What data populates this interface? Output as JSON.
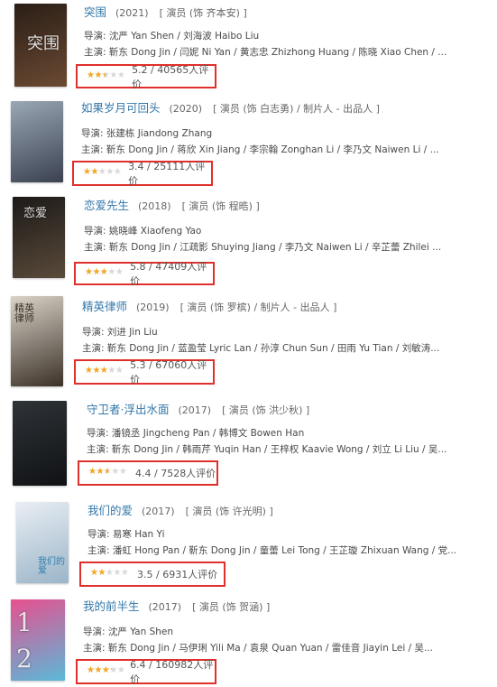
{
  "items": [
    {
      "title": "突围",
      "year": "(2021)",
      "role": "[ 演员 (饰 齐本安) ]",
      "director": "导演: 沈严 Yan Shen / 刘海波 Haibo Liu",
      "cast": "主演: 靳东 Dong Jin / 闫妮 Ni Yan / 黄志忠 Zhizhong Huang / 陈晓 Xiao Chen / ...",
      "score": "5.2 / 40565人评价",
      "stars": 2.5,
      "poster_colors": [
        "#2a1e16",
        "#6b4a33"
      ],
      "poster_text": "突围"
    },
    {
      "title": "如果岁月可回头",
      "year": "(2020)",
      "role": "[ 演员 (饰 白志勇) / 制片人 - 出品人 ]",
      "director": "导演: 张建栋 Jiandong Zhang",
      "cast": "主演: 靳东 Dong Jin / 蒋欣 Xin Jiang / 李宗翰 Zonghan Li / 李乃文 Naiwen Li / ...",
      "score": "3.4 / 25111人评价",
      "stars": 2,
      "poster_colors": [
        "#9aa7b5",
        "#3a4150"
      ],
      "poster_text": ""
    },
    {
      "title": "恋爱先生",
      "year": "(2018)",
      "role": "[ 演员 (饰 程晧) ]",
      "director": "导演: 姚晓峰 Xiaofeng Yao",
      "cast": "主演: 靳东 Dong Jin / 江疏影 Shuying Jiang / 李乃文 Naiwen Li / 辛芷蕾 Zhilei ...",
      "score": "5.8 / 47409人评价",
      "stars": 3,
      "poster_colors": [
        "#1c1a18",
        "#5a4a3a"
      ],
      "poster_text": "恋爱"
    },
    {
      "title": "精英律师",
      "year": "(2019)",
      "role": "[ 演员 (饰 罗槟) / 制片人 - 出品人 ]",
      "director": "导演: 刘进 Jin Liu",
      "cast": "主演: 靳东 Dong Jin / 蓝盈莹 Lyric Lan / 孙淳 Chun Sun / 田雨 Yu Tian / 刘敏涛...",
      "score": "5.3 / 67060人评价",
      "stars": 2.5,
      "poster_colors": [
        "#d9d3c8",
        "#3b3128"
      ],
      "poster_text": "精英律师"
    },
    {
      "title": "守卫者·浮出水面",
      "year": "(2017)",
      "role": "[ 演员 (饰 洪少秋) ]",
      "director": "导演: 潘镜丞 Jingcheng Pan / 韩博文 Bowen Han",
      "cast": "主演: 靳东 Dong Jin / 韩雨芹 Yuqin Han / 王梓权 Kaavie Wong / 刘立 Li Liu / 吴...",
      "score": "4.4 / 7528人评价",
      "stars": 2.5,
      "poster_colors": [
        "#2e3338",
        "#101214"
      ],
      "poster_text": ""
    },
    {
      "title": "我们的爱",
      "year": "(2017)",
      "role": "[ 演员 (饰 许光明) ]",
      "director": "导演: 易寒 Han Yi",
      "cast": "主演: 潘虹 Hong Pan / 靳东 Dong Jin / 童蕾 Lei Tong / 王芷璇 Zhixuan Wang / 党...",
      "score": "3.5 / 6931人评价",
      "stars": 2,
      "poster_colors": [
        "#e9eef3",
        "#9bb5c9"
      ],
      "poster_text": "我们的爱"
    },
    {
      "title": "我的前半生",
      "year": "(2017)",
      "role": "[ 演员 (饰 贺涵) ]",
      "director": "导演: 沈严 Yan Shen",
      "cast": "主演: 靳东 Dong Jin / 马伊琍 Yili Ma / 袁泉 Quan Yuan / 雷佳音 Jiayin Lei / 吴...",
      "score": "6.4 / 160982人评价",
      "stars": 3.5,
      "poster_colors": [
        "#e7508f",
        "#5ab9d8"
      ],
      "poster_text": "1 2"
    }
  ],
  "star_glyphs": "★★★★★",
  "accent_color": "#e0302b"
}
